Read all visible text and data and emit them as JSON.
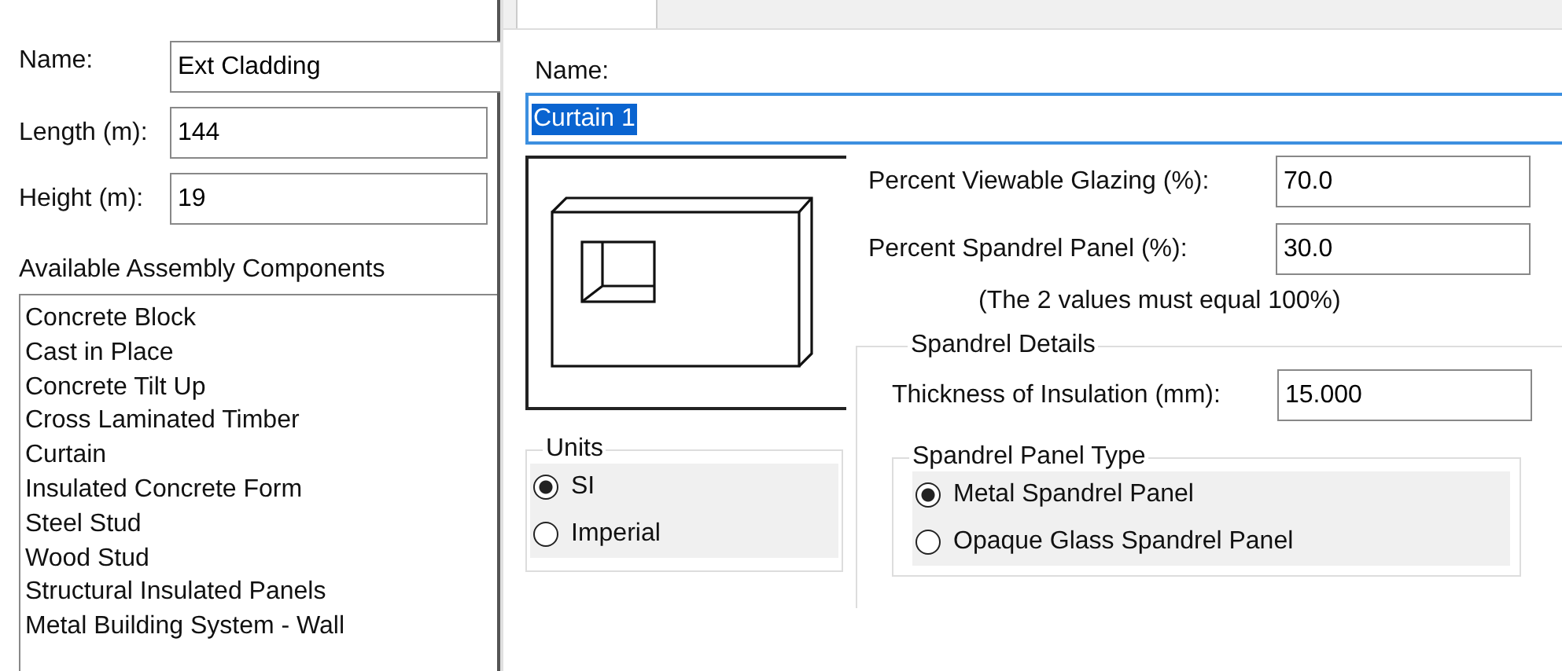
{
  "left_panel": {
    "fields": [
      {
        "label": "Name:",
        "value": "Ext Cladding"
      },
      {
        "label": "Length (m):",
        "value": "144"
      },
      {
        "label": "Height (m):",
        "value": "19"
      }
    ],
    "components_label": "Available Assembly Components",
    "components": [
      "Concrete Block",
      "Cast in Place",
      "Concrete Tilt Up",
      "Cross Laminated Timber",
      "Curtain",
      "Insulated Concrete Form",
      "Steel Stud",
      "Wood Stud",
      "Structural Insulated Panels",
      "Metal Building System - Wall"
    ]
  },
  "assembly": {
    "name_label": "Name:",
    "name_value": "Curtain 1",
    "name_value_highlighted": true,
    "percent_fields": [
      {
        "label": "Percent Viewable Glazing (%):",
        "value": "70.0"
      },
      {
        "label": "Percent Spandrel Panel (%):",
        "value": "30.0"
      }
    ],
    "note": "(The 2 values must equal 100%)",
    "units": {
      "title": "Units",
      "options": [
        {
          "label": "SI",
          "selected": true
        },
        {
          "label": "Imperial",
          "selected": false
        }
      ]
    },
    "spandrel_details": {
      "title": "Spandrel Details",
      "thickness_label": "Thickness of Insulation (mm):",
      "thickness_value": "15.000",
      "panel_type": {
        "title": "Spandrel Panel Type",
        "options": [
          {
            "label": "Metal Spandrel Panel",
            "selected": true
          },
          {
            "label": "Opaque Glass Spandrel Panel",
            "selected": false
          }
        ]
      }
    }
  }
}
